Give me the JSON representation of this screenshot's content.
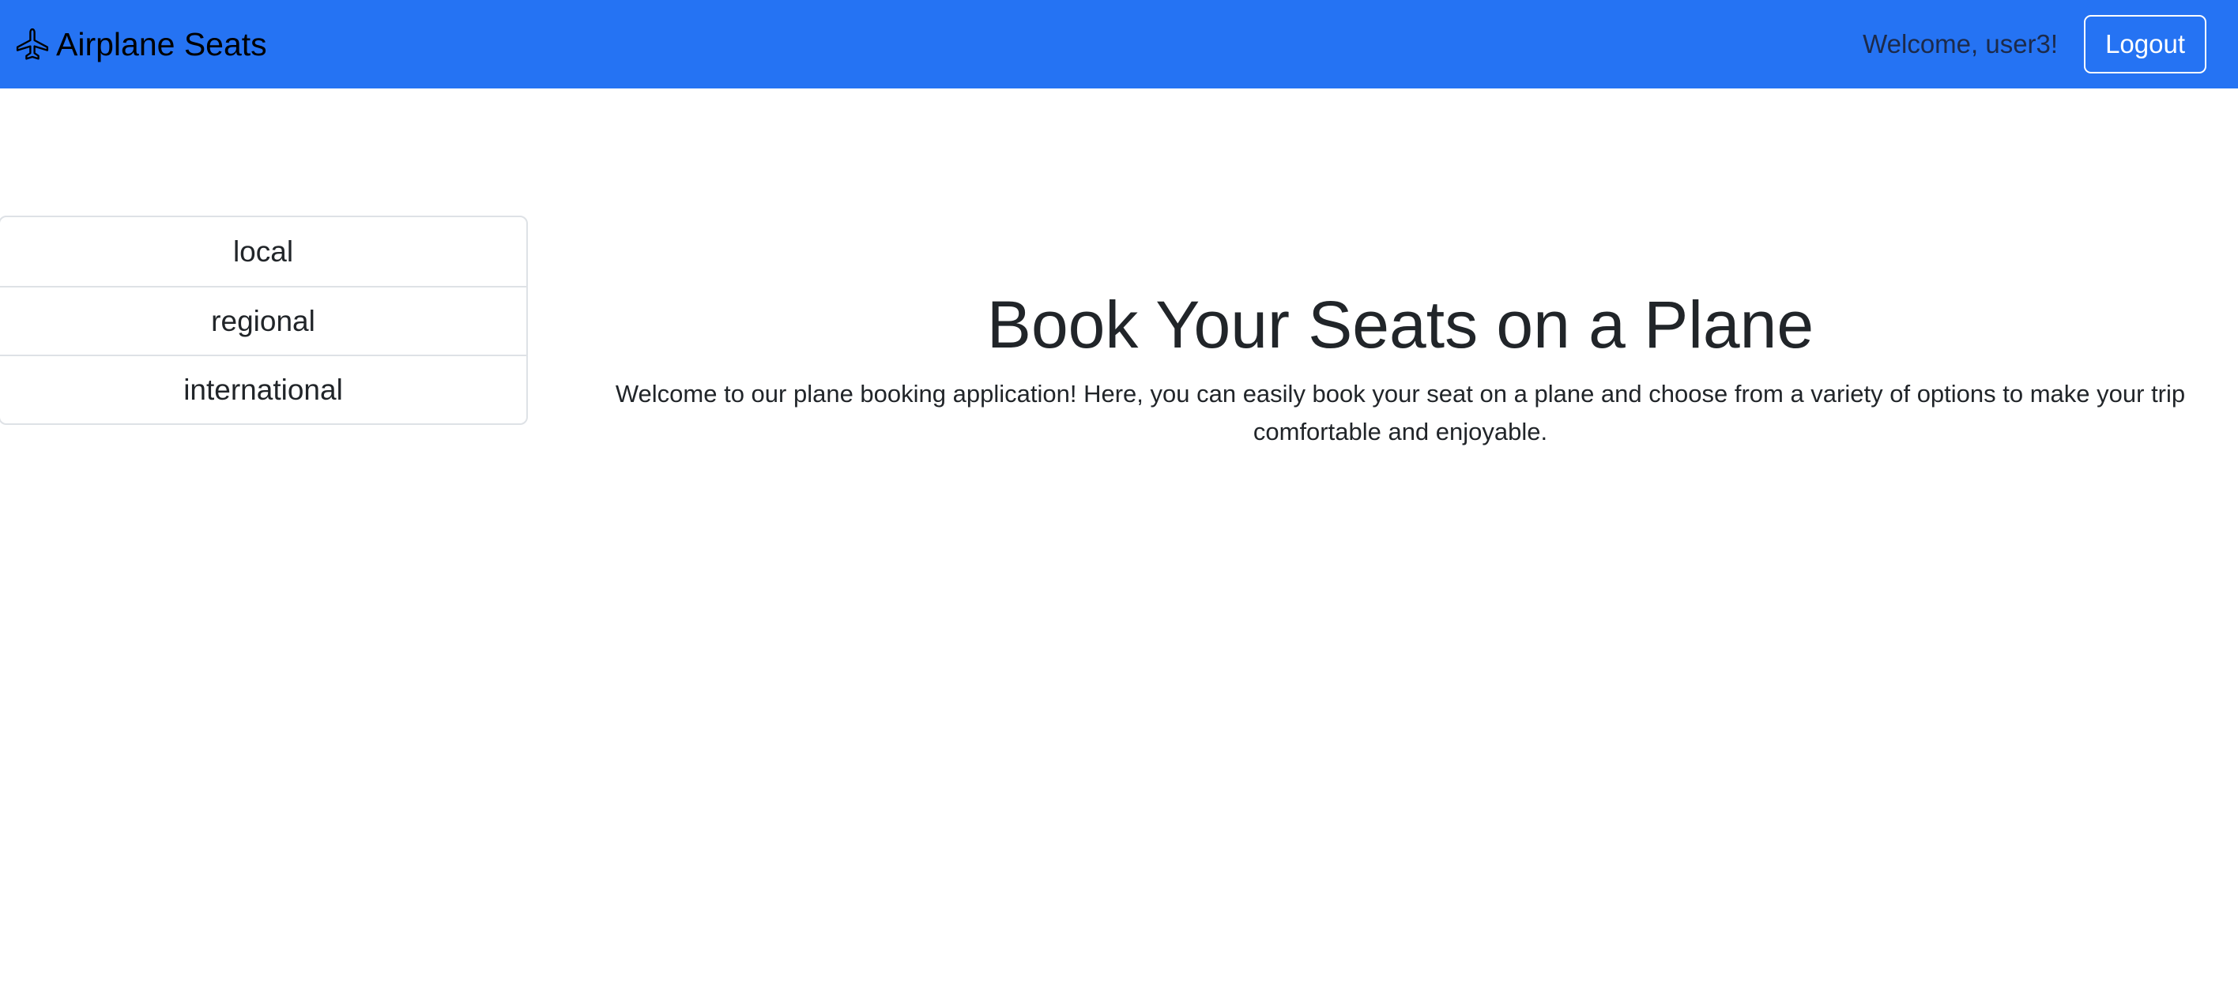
{
  "navbar": {
    "brand_icon": "airplane-icon",
    "brand_label": "Airplane Seats",
    "welcome_text": "Welcome, user3!",
    "logout_label": "Logout",
    "background_color": "#2573f3"
  },
  "sidebar": {
    "items": [
      {
        "label": "local"
      },
      {
        "label": "regional"
      },
      {
        "label": "international"
      }
    ]
  },
  "main": {
    "title": "Book Your Seats on a Plane",
    "description": "Welcome to our plane booking application! Here, you can easily book your seat on a plane and choose from a variety of options to make your trip comfortable and enjoyable."
  }
}
